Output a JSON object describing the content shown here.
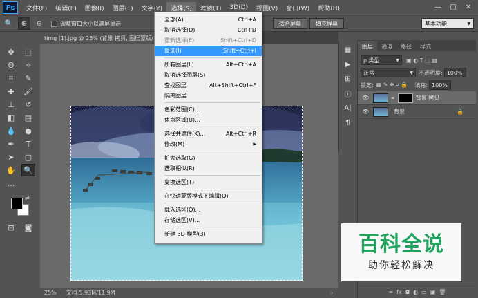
{
  "app": {
    "logo": "Ps"
  },
  "menubar": {
    "items": [
      "文件(F)",
      "编辑(E)",
      "图像(I)",
      "图层(L)",
      "文字(Y)",
      "选择(S)",
      "滤镜(T)",
      "3D(D)",
      "视图(V)",
      "窗口(W)",
      "帮助(H)"
    ]
  },
  "window_controls": {
    "minimize": "—",
    "maximize": "□",
    "close": "✕"
  },
  "optionsbar": {
    "checkbox_label": "调整窗口大小以满屏显示",
    "fit_screen": "适合屏幕",
    "fill_screen": "填充屏幕",
    "workspace": "基本功能"
  },
  "document": {
    "tab_title": "timg (1).jpg @ 25% (背景 拷贝, 图层蒙版/",
    "tab_close": "×",
    "zoom": "25%",
    "doc_size": "文档:5.93M/11.9M"
  },
  "select_menu": {
    "items": [
      {
        "label": "全部(A)",
        "shortcut": "Ctrl+A",
        "state": "normal"
      },
      {
        "label": "取消选择(D)",
        "shortcut": "Ctrl+D",
        "state": "normal"
      },
      {
        "label": "重新选择(E)",
        "shortcut": "Shift+Ctrl+D",
        "state": "disabled"
      },
      {
        "label": "反选(I)",
        "shortcut": "Shift+Ctrl+I",
        "state": "highlighted"
      },
      {
        "separator": true
      },
      {
        "label": "所有图层(L)",
        "shortcut": "Alt+Ctrl+A",
        "state": "normal"
      },
      {
        "label": "取消选择图层(S)",
        "shortcut": "",
        "state": "normal"
      },
      {
        "label": "查找图层",
        "shortcut": "Alt+Shift+Ctrl+F",
        "state": "normal"
      },
      {
        "label": "隔离图层",
        "shortcut": "",
        "state": "normal"
      },
      {
        "separator": true
      },
      {
        "label": "色彩范围(C)...",
        "shortcut": "",
        "state": "normal"
      },
      {
        "label": "焦点区域(U)...",
        "shortcut": "",
        "state": "normal"
      },
      {
        "separator": true
      },
      {
        "label": "选择并遮住(K)...",
        "shortcut": "Alt+Ctrl+R",
        "state": "normal"
      },
      {
        "label": "修改(M)",
        "shortcut": "",
        "state": "submenu"
      },
      {
        "separator": true
      },
      {
        "label": "扩大选取(G)",
        "shortcut": "",
        "state": "normal"
      },
      {
        "label": "选取相似(R)",
        "shortcut": "",
        "state": "normal"
      },
      {
        "separator": true
      },
      {
        "label": "变换选区(T)",
        "shortcut": "",
        "state": "normal"
      },
      {
        "separator": true
      },
      {
        "label": "在快速蒙版模式下编辑(Q)",
        "shortcut": "",
        "state": "normal"
      },
      {
        "separator": true
      },
      {
        "label": "载入选区(O)...",
        "shortcut": "",
        "state": "normal"
      },
      {
        "label": "存储选区(V)...",
        "shortcut": "",
        "state": "normal"
      },
      {
        "separator": true
      },
      {
        "label": "新建 3D 模型(3)",
        "shortcut": "",
        "state": "normal"
      }
    ]
  },
  "layers_panel": {
    "tabs": [
      "图层",
      "通道",
      "路径",
      "样式"
    ],
    "filter_kind": "ρ 类型",
    "blend_mode": "正常",
    "opacity_label": "不透明度:",
    "opacity_value": "100%",
    "lock_label": "锁定:",
    "fill_label": "填充:",
    "fill_value": "100%",
    "layers": [
      {
        "name": "背景 拷贝",
        "selected": true,
        "has_mask": true
      },
      {
        "name": "背景",
        "selected": false,
        "has_mask": false,
        "locked": true
      }
    ],
    "bottom_icons": [
      "∞",
      "fx",
      "◘",
      "◐",
      "▭",
      "▣",
      "🗑"
    ]
  },
  "watermark": {
    "title": "百科全说",
    "subtitle": "助你轻松解决"
  },
  "colors": {
    "ui_bg": "#535353",
    "menu_bg": "#f0f0f0",
    "menu_highlight": "#3399ff",
    "watermark_green": "#21a35e"
  }
}
